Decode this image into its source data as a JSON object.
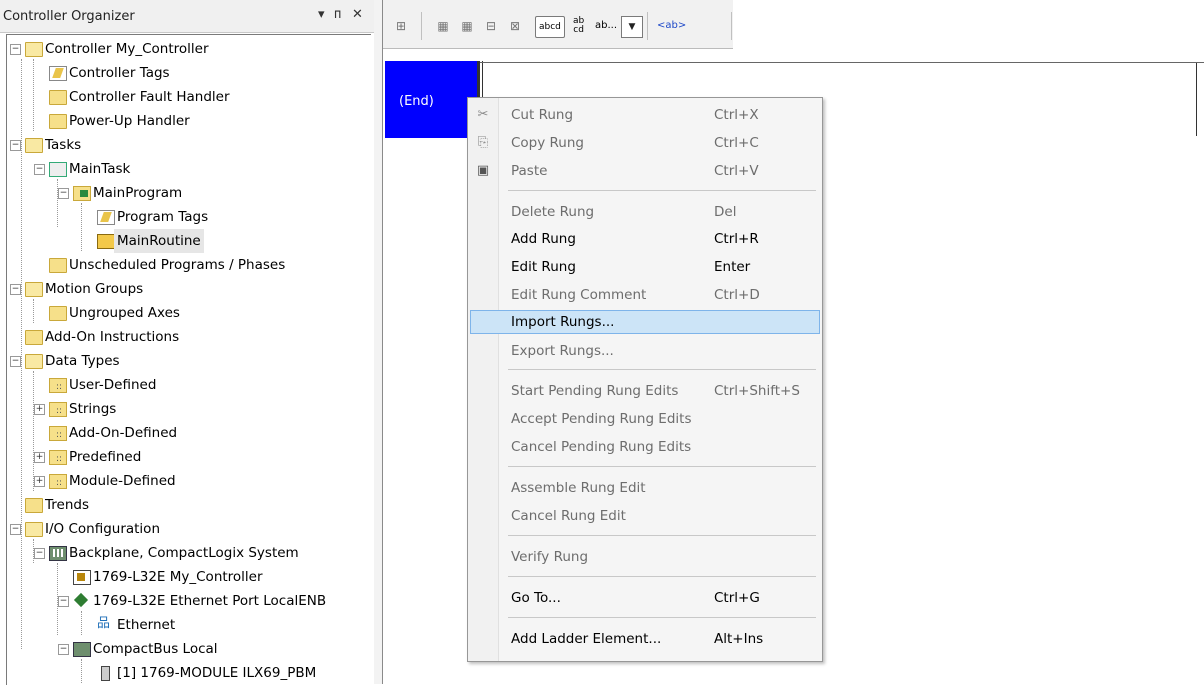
{
  "organizer": {
    "title": "Controller Organizer",
    "pin_glyph": "▾ ⁠ɪ",
    "close_glyph": "✕"
  },
  "tree": [
    {
      "label": "Controller My_Controller",
      "icon": "folder-open-icon",
      "expander": "minus"
    },
    {
      "label": "Controller Tags",
      "icon": "tag-edit-icon"
    },
    {
      "label": "Controller Fault Handler",
      "icon": "folder-icon"
    },
    {
      "label": "Power-Up Handler",
      "icon": "folder-icon"
    },
    {
      "label": "Tasks",
      "icon": "folder-open-icon",
      "expander": "minus"
    },
    {
      "label": "MainTask",
      "icon": "task-icon",
      "expander": "minus"
    },
    {
      "label": "MainProgram",
      "icon": "program-icon",
      "expander": "minus"
    },
    {
      "label": "Program Tags",
      "icon": "tag-edit-icon"
    },
    {
      "label": "MainRoutine",
      "icon": "routine-icon",
      "selected": true
    },
    {
      "label": "Unscheduled Programs / Phases",
      "icon": "folder-icon"
    },
    {
      "label": "Motion Groups",
      "icon": "folder-open-icon",
      "expander": "minus"
    },
    {
      "label": "Ungrouped Axes",
      "icon": "folder-icon"
    },
    {
      "label": "Add-On Instructions",
      "icon": "folder-icon"
    },
    {
      "label": "Data Types",
      "icon": "folder-open-icon",
      "expander": "minus"
    },
    {
      "label": "User-Defined",
      "icon": "datatype-icon"
    },
    {
      "label": "Strings",
      "icon": "datatype-icon",
      "expander": "plus"
    },
    {
      "label": "Add-On-Defined",
      "icon": "datatype-icon"
    },
    {
      "label": "Predefined",
      "icon": "datatype-icon",
      "expander": "plus"
    },
    {
      "label": "Module-Defined",
      "icon": "datatype-icon",
      "expander": "plus"
    },
    {
      "label": "Trends",
      "icon": "folder-icon"
    },
    {
      "label": "I/O Configuration",
      "icon": "folder-open-icon",
      "expander": "minus"
    },
    {
      "label": "Backplane, CompactLogix System",
      "icon": "backplane-icon",
      "expander": "minus"
    },
    {
      "label": "1769-L32E My_Controller",
      "icon": "controller-module-icon"
    },
    {
      "label": "1769-L32E Ethernet Port LocalENB",
      "icon": "ethernet-port-icon",
      "expander": "minus"
    },
    {
      "label": "Ethernet",
      "icon": "network-icon"
    },
    {
      "label": "CompactBus Local",
      "icon": "compactbus-icon",
      "expander": "minus"
    },
    {
      "label": "[1] 1769-MODULE ILX69_PBM",
      "icon": "io-module-icon"
    }
  ],
  "toolbar": {
    "mode_label": "abcd",
    "ab_label": "ab",
    "cd_label": "cd",
    "combo_label": "ab...",
    "ab_tag_label": "<ab>"
  },
  "ladder": {
    "end_label": "(End)"
  },
  "context_menu": {
    "items": [
      {
        "label": "Cut Rung",
        "shortcut": "Ctrl+X",
        "enabled": false,
        "icon": "cut-icon"
      },
      {
        "label": "Copy Rung",
        "shortcut": "Ctrl+C",
        "enabled": false,
        "icon": "copy-icon"
      },
      {
        "label": "Paste",
        "shortcut": "Ctrl+V",
        "enabled": false,
        "icon": "paste-icon"
      },
      {
        "label": "Delete Rung",
        "shortcut": "Del",
        "enabled": false
      },
      {
        "label": "Add Rung",
        "shortcut": "Ctrl+R",
        "enabled": true
      },
      {
        "label": "Edit Rung",
        "shortcut": "Enter",
        "enabled": true
      },
      {
        "label": "Edit Rung Comment",
        "shortcut": "Ctrl+D",
        "enabled": false
      },
      {
        "label": "Import Rungs...",
        "shortcut": "",
        "enabled": true,
        "highlighted": true
      },
      {
        "label": "Export Rungs...",
        "shortcut": "",
        "enabled": false
      },
      {
        "label": "Start Pending Rung Edits",
        "shortcut": "Ctrl+Shift+S",
        "enabled": false
      },
      {
        "label": "Accept Pending Rung Edits",
        "shortcut": "",
        "enabled": false
      },
      {
        "label": "Cancel Pending Rung Edits",
        "shortcut": "",
        "enabled": false
      },
      {
        "label": "Assemble Rung Edit",
        "shortcut": "",
        "enabled": false
      },
      {
        "label": "Cancel Rung Edit",
        "shortcut": "",
        "enabled": false
      },
      {
        "label": "Verify Rung",
        "shortcut": "",
        "enabled": false
      },
      {
        "label": "Go To...",
        "shortcut": "Ctrl+G",
        "enabled": true
      },
      {
        "label": "Add Ladder Element...",
        "shortcut": "Alt+Ins",
        "enabled": true
      }
    ]
  },
  "colors": {
    "end_box": "#0000ff",
    "menu_highlight": "#cce4f7",
    "menu_highlight_border": "#7eb4ea"
  }
}
